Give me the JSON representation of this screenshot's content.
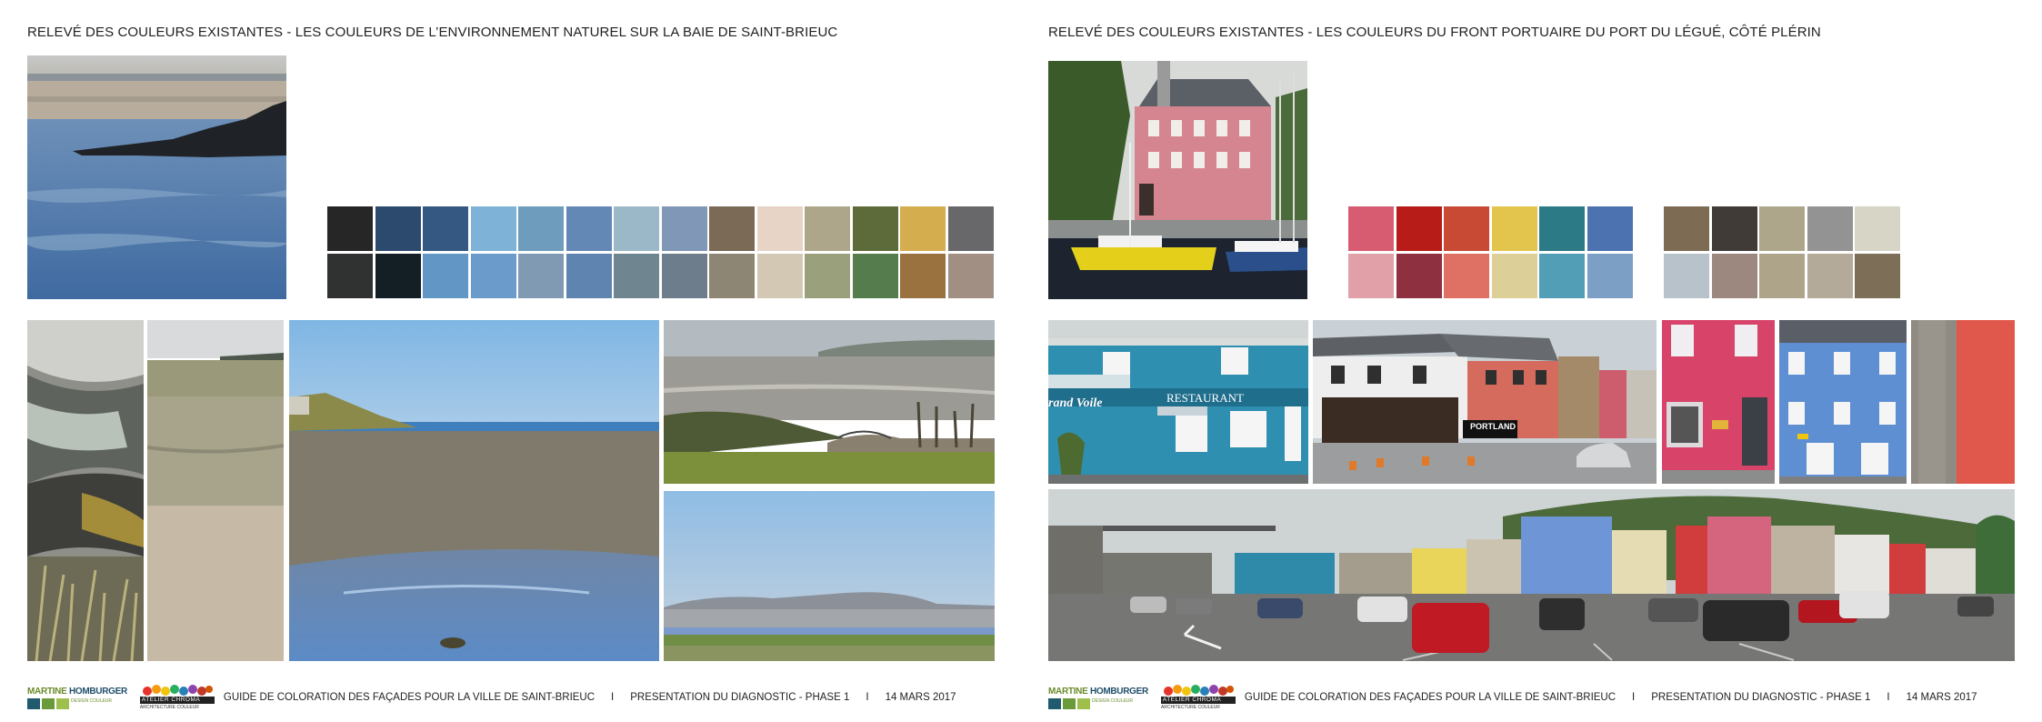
{
  "left_panel": {
    "title": "RELEVÉ DES COULEURS EXISTANTES - LES COULEURS DE L’ENVIRONNEMENT NATUREL SUR LA BAIE DE SAINT-BRIEUC",
    "swatches_row1": [
      "#262626",
      "#2c4a6e",
      "#345882",
      "#7fb2d7",
      "#6e9cbd",
      "#6488b6",
      "#9bb8c9",
      "#8097b7",
      "#7a6a56",
      "#e7d4c6",
      "#aea68a",
      "#5d6b3a",
      "#d4ad4e",
      "#68686a"
    ],
    "swatches_row2": [
      "#303131",
      "#141e25",
      "#6296c4",
      "#6a9bca",
      "#7f9ab2",
      "#5f84af",
      "#6f8590",
      "#6d7d8c",
      "#8e8674",
      "#d2c8b3",
      "#9aa07c",
      "#557c4d",
      "#9a7240",
      "#a08f82"
    ]
  },
  "right_panel": {
    "title": "RELEVÉ DES COULEURS EXISTANTES - LES COULEURS DU FRONT PORTUAIRE DU PORT DU LÉGUÉ, CÔTÉ PLÉRIN",
    "swatches_group1_row1": [
      "#d75c72",
      "#b71c19",
      "#c84a35",
      "#e3c54e",
      "#2d7a87",
      "#4c72b0"
    ],
    "swatches_group1_row2": [
      "#e1a0a7",
      "#8e303f",
      "#df7064",
      "#ddcf98",
      "#519eb6",
      "#7c9fc6"
    ],
    "swatches_group2_row1": [
      "#7d6b54",
      "#403b37",
      "#aea68a",
      "#939393",
      "#d6d5c6"
    ],
    "swatches_group2_row2": [
      "#b8c2ca",
      "#9c887e",
      "#aea48a",
      "#b4aa9a",
      "#7d6e57"
    ],
    "photo_texts": {
      "restaurant_sign": "RESTAURANT",
      "grand_voile_sign": "rand Voile",
      "portland_sign": "PORTLAND"
    }
  },
  "footer": {
    "guide_label": "GUIDE DE COLORATION DES FAÇADES POUR LA VILLE DE SAINT-BRIEUC",
    "separator": "I",
    "phase_label": "PRESENTATION DU DIAGNOSTIC - PHASE 1",
    "date_label": "14 MARS 2017",
    "logo_mh_name_a": "MARTINE",
    "logo_mh_name_b": "HOMBURGER",
    "logo_mh_sub": "DESIGN COULEUR",
    "logo_ac_name": "ATELIER CHROMA",
    "logo_ac_sub": "ARCHITECTURE COULEUR"
  }
}
